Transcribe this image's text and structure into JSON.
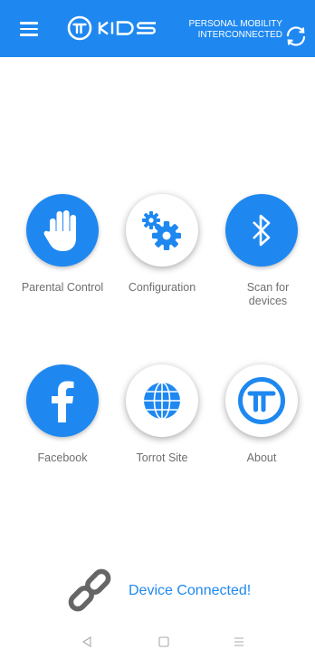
{
  "header": {
    "brand": "KIDS",
    "tagline_line1": "PERSONAL MOBILITY",
    "tagline_line2": "INTERCONNECTED",
    "background_color": "#1e88f0",
    "menu_icon": "hamburger-menu-icon",
    "refresh_icon": "refresh-icon"
  },
  "tiles": [
    {
      "label": "Parental Control",
      "icon": "hand-icon",
      "style": "blue"
    },
    {
      "label": "Configuration",
      "icon": "gears-icon",
      "style": "white"
    },
    {
      "label": "Scan for devices",
      "icon": "bluetooth-icon",
      "style": "blue"
    },
    {
      "label": "Facebook",
      "icon": "facebook-icon",
      "style": "blue"
    },
    {
      "label": "Torrot Site",
      "icon": "globe-icon",
      "style": "white"
    },
    {
      "label": "About",
      "icon": "torrot-logo-icon",
      "style": "white"
    }
  ],
  "status": {
    "text": "Device Connected!",
    "icon": "link-icon",
    "color": "#1e88f0"
  },
  "system_nav": {
    "back_icon": "back-triangle-icon",
    "home_icon": "home-square-icon",
    "recents_icon": "recents-lines-icon"
  }
}
